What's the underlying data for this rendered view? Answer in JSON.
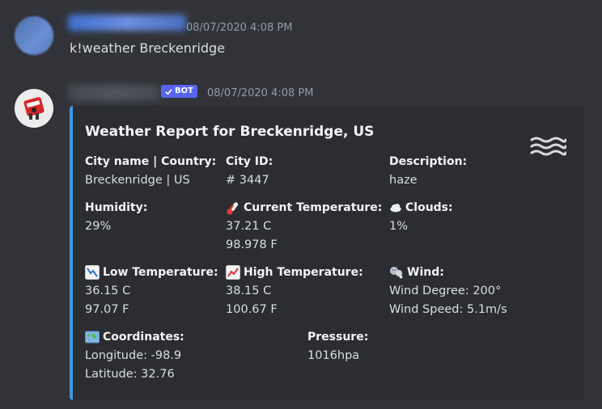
{
  "message1": {
    "timestamp": "08/07/2020 4:08 PM",
    "text": "k!weather Breckenridge"
  },
  "message2": {
    "bot_tag": "BOT",
    "timestamp": "08/07/2020 4:08 PM",
    "embed": {
      "title": "Weather Report for Breckenridge, US",
      "accent_color": "#3f98e0",
      "thumbnail_icon": "fog-waves-icon",
      "fields": {
        "city": {
          "name": "City name | Country:",
          "value": "Breckenridge | US"
        },
        "city_id": {
          "name": "City ID:",
          "value": "# 3447"
        },
        "description": {
          "name": "Description:",
          "value": "haze"
        },
        "humidity": {
          "name": "Humidity:",
          "value": "29%"
        },
        "current_temp": {
          "name": "Current Temperature:",
          "icon": "thermometer-icon",
          "value_c": "37.21 C",
          "value_f": "98.978 F"
        },
        "clouds": {
          "name": "Clouds:",
          "icon": "cloud-icon",
          "value": "1%"
        },
        "low_temp": {
          "name": "Low Temperature:",
          "icon": "chart-decreasing-icon",
          "value_c": "36.15 C",
          "value_f": "97.07 F"
        },
        "high_temp": {
          "name": "High Temperature:",
          "icon": "chart-increasing-icon",
          "value_c": "38.15 C",
          "value_f": "100.67 F"
        },
        "wind": {
          "name": "Wind:",
          "icon": "wind-face-icon",
          "degree": "Wind Degree: 200°",
          "speed": "Wind Speed: 5.1m/s"
        },
        "coordinates": {
          "name": "Coordinates:",
          "icon": "world-map-icon",
          "longitude": "Longitude: -98.9",
          "latitude": "Latitude: 32.76"
        },
        "pressure": {
          "name": "Pressure:",
          "value": "1016hpa"
        }
      }
    }
  },
  "colors": {
    "background": "#313338",
    "embed_background": "#2b2d31",
    "bot_tag": "#5865f2",
    "timestamp": "#949ba4"
  }
}
